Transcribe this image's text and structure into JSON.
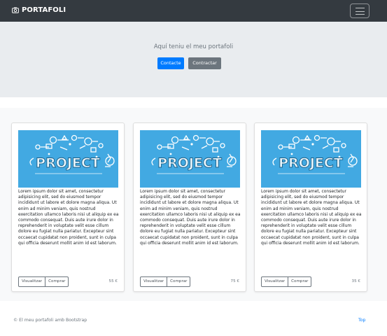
{
  "navbar": {
    "brand": "PORTAFOLI",
    "brand_icon": "camera-icon",
    "toggler_icon": "hamburger-menu-icon"
  },
  "jumbotron": {
    "lead": "Aquí teniu el meu portafoli",
    "primary_button": "Contacte",
    "secondary_button": "Contractar"
  },
  "cards": [
    {
      "image_text": "PROJECT",
      "text": "Lorem ipsum dolor sit amet, consectetur adipisicing elit, sed do eiusmod tempor incididunt ut labore et dolore magna aliqua. Ut enim ad minim veniam, quis nostrud exercitation ullamco laboris nisi ut aliquip ex ea commodo consequat. Duis aute irure dolor in reprehenderit in voluptate velit esse cillum dolore eu fugiat nulla pariatur. Excepteur sint occaecat cupidatat non proident, sunt in culpa qui officia deserunt mollit anim id est laborum.",
      "view_label": "Visualitzar",
      "buy_label": "Comprar",
      "price": "55 €"
    },
    {
      "image_text": "PROJECT",
      "text": "Lorem ipsum dolor sit amet, consectetur adipisicing elit, sed do eiusmod tempor incididunt ut labore et dolore magna aliqua. Ut enim ad minim veniam, quis nostrud exercitation ullamco laboris nisi ut aliquip ex ea commodo consequat. Duis aute irure dolor in reprehenderit in voluptate velit esse cillum dolore eu fugiat nulla pariatur. Excepteur sint occaecat cupidatat non proident, sunt in culpa qui officia deserunt mollit anim id est laborum.",
      "view_label": "Visualitzar",
      "buy_label": "Comprar",
      "price": "75 €"
    },
    {
      "image_text": "PROJECT",
      "text": "Lorem ipsum dolor sit amet, consectetur adipisicing elit, sed do eiusmod tempor incididunt ut labore et dolore magna aliqua. Ut enim ad minim veniam, quis nostrud exercitation ullamco laboris nisi ut aliquip ex ea commodo consequat. Duis aute irure dolor in reprehenderit in voluptate velit esse cillum dolore eu fugiat nulla pariatur. Excepteur sint occaecat cupidatat non proident, sunt in culpa qui officia deserunt mollit anim id est laborum.",
      "view_label": "Visualitzar",
      "buy_label": "Comprar",
      "price": "35 €"
    }
  ],
  "footer": {
    "text": "© El meu portafoli amb Bootstrap",
    "top_link": "Top"
  },
  "colors": {
    "navbar": "#343a40",
    "jumbotron": "#e9ecef",
    "primary": "#007bff",
    "secondary": "#6c757d",
    "project_image": "#42a9e2"
  }
}
